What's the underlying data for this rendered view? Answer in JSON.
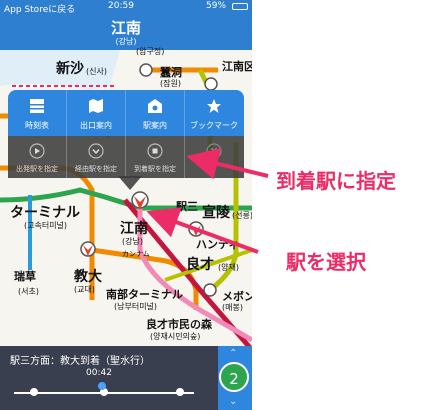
{
  "statusbar": {
    "back": "App Storeに戻る",
    "time": "20:59",
    "battery": "59%"
  },
  "header": {
    "title": "江南",
    "subtitle": "(강남)"
  },
  "map": {
    "stations": [
      {
        "id": "sinsa",
        "name": "新沙",
        "sub": "(신사)"
      },
      {
        "id": "jamwon",
        "name": "蠶洞",
        "sub": "(잠원)"
      },
      {
        "id": "gangnamgu",
        "name": "江南区",
        "sub": ""
      },
      {
        "id": "apgujeong",
        "name": "(압구정)",
        "sub": ""
      },
      {
        "id": "terminal",
        "name": "ターミナル",
        "sub": "(고속터미널)"
      },
      {
        "id": "gangnam",
        "name": "江南",
        "sub": "(강남)",
        "kana": "カンナム"
      },
      {
        "id": "yeoksam",
        "name": "駅三",
        "sub": ""
      },
      {
        "id": "seolleung",
        "name": "宣陵",
        "sub": "(선릉)"
      },
      {
        "id": "hanti",
        "name": "ハンティ",
        "sub": ""
      },
      {
        "id": "yangjae",
        "name": "良才",
        "sub": "(양재)"
      },
      {
        "id": "seocho",
        "name": "瑞草",
        "sub": "(서초)"
      },
      {
        "id": "gyodae",
        "name": "教大",
        "sub": "(교대)"
      },
      {
        "id": "nambu",
        "name": "南部ターミナル",
        "sub": "(남부터미널)"
      },
      {
        "id": "maebong",
        "name": "メボン",
        "sub": "(매봉)"
      },
      {
        "id": "citizens",
        "name": "良才市民の森",
        "sub": "(양재시민의숲)"
      }
    ]
  },
  "popup": {
    "main": [
      {
        "label": "時刻表",
        "icon": "timetable-icon"
      },
      {
        "label": "出口案内",
        "icon": "map-icon"
      },
      {
        "label": "駅案内",
        "icon": "station-info-icon"
      },
      {
        "label": "ブックマーク",
        "icon": "star-icon"
      }
    ],
    "actions": [
      {
        "label": "出発駅を指定",
        "icon": "play-icon"
      },
      {
        "label": "経由駅を指定",
        "icon": "check-icon"
      },
      {
        "label": "到着駅を指定",
        "icon": "stop-icon"
      },
      {
        "label": "",
        "icon": "close-icon"
      }
    ]
  },
  "bottom": {
    "direction": "駅三方面：教大到着（聖水行）",
    "time": "00:42",
    "line_number": "2"
  },
  "annotations": {
    "arrival": "到着駅に指定",
    "select": "駅を選択"
  },
  "colors": {
    "header": "#2f7fd0",
    "line2": "#2da44e",
    "line3": "#f08a00",
    "line4": "#2a9ad8",
    "shinbundang": "#c4163c",
    "annotation": "#ec2c67"
  }
}
